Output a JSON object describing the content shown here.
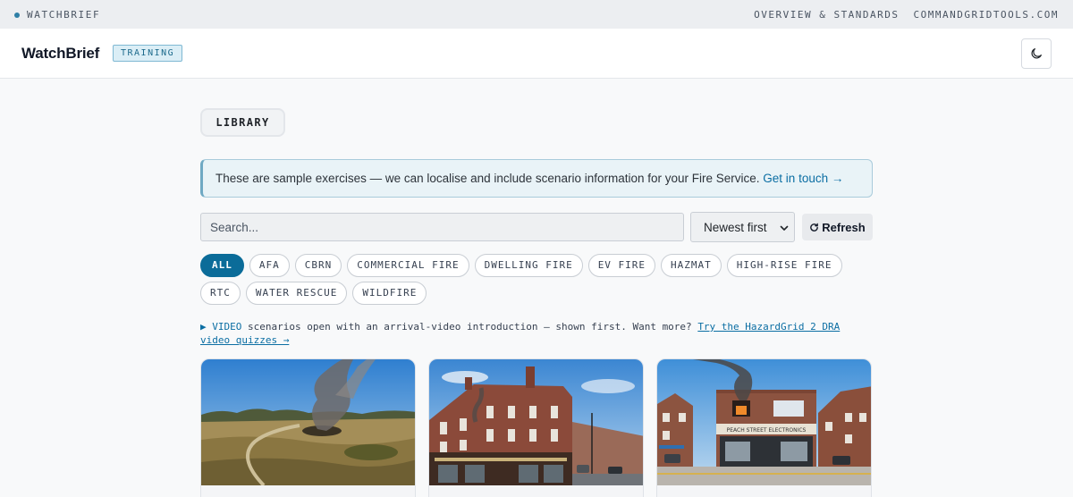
{
  "topbar": {
    "brand": "WATCHBRIEF",
    "links": [
      "OVERVIEW & STANDARDS",
      "COMMANDGRIDTOOLS.COM"
    ]
  },
  "header": {
    "title": "WatchBrief",
    "badge": "TRAINING",
    "theme_icon": "moon-icon"
  },
  "library_label": "LIBRARY",
  "notice": {
    "text": "These are sample exercises — we can localise and include scenario information for your Fire Service.",
    "link": "Get in touch →"
  },
  "search": {
    "placeholder": "Search..."
  },
  "sort": {
    "selected": "Newest first"
  },
  "refresh_label": "Refresh",
  "filters": [
    "ALL",
    "AFA",
    "CBRN",
    "COMMERCIAL FIRE",
    "DWELLING FIRE",
    "EV FIRE",
    "HAZMAT",
    "HIGH-RISE FIRE",
    "RTC",
    "WATER RESCUE",
    "WILDFIRE"
  ],
  "video_note": {
    "tag": "▶ VIDEO",
    "text": "scenarios open with an arrival-video introduction — shown first. Want more?",
    "link": "Try the HazardGrid 2 DRA video quizzes →"
  },
  "colors": {
    "accent": "#0b6c99",
    "notice_bg": "#e9f3f7",
    "badge_bg": "#dbeef6"
  }
}
